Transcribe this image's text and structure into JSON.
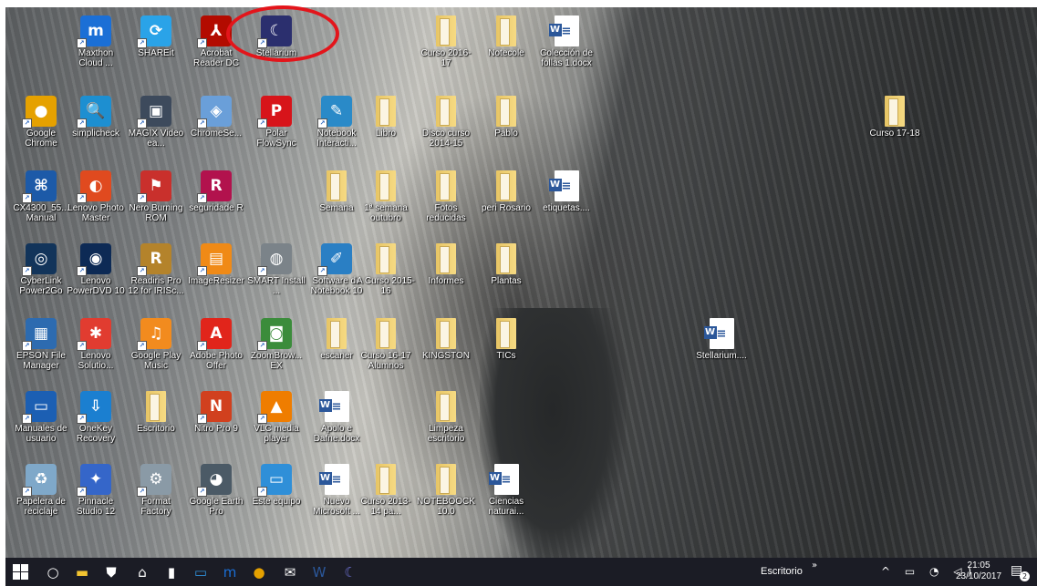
{
  "desktop_icons": [
    {
      "name": "icon-maxthon",
      "label": "Maxthon Cloud ...",
      "icon": "maxthon-icon",
      "glyph": "m",
      "bg": "#1b6fd6",
      "kind": "app"
    },
    {
      "name": "icon-shareit",
      "label": "SHAREit",
      "icon": "shareit-icon",
      "glyph": "⟳",
      "bg": "#2aa3e8",
      "kind": "app"
    },
    {
      "name": "icon-acrobat",
      "label": "Acrobat Reader DC",
      "icon": "acrobat-icon",
      "glyph": "⅄",
      "bg": "#b30b00",
      "kind": "app"
    },
    {
      "name": "icon-stellarium",
      "label": "Stellarium",
      "icon": "stellarium-icon",
      "glyph": "☾",
      "bg": "#2b2f6e",
      "kind": "app"
    },
    {
      "name": "icon-curso-2016-17",
      "label": "Curso 2016-17",
      "icon": "folder-icon",
      "glyph": "",
      "bg": "",
      "kind": "folder"
    },
    {
      "name": "icon-notecole",
      "label": "Notecole",
      "icon": "folder-icon",
      "glyph": "",
      "bg": "",
      "kind": "folder"
    },
    {
      "name": "icon-coleccion-follas",
      "label": "Colección de follas 1.docx",
      "icon": "word-doc-icon",
      "glyph": "≡",
      "bg": "",
      "kind": "doc"
    },
    {
      "name": "icon-google-chrome",
      "label": "Google Chrome",
      "icon": "chrome-icon",
      "glyph": "●",
      "bg": "#e5a100",
      "kind": "app"
    },
    {
      "name": "icon-simplicheck",
      "label": "simplicheck",
      "icon": "magnifier-icon",
      "glyph": "🔍",
      "bg": "#1d8fd1",
      "kind": "app"
    },
    {
      "name": "icon-magix-video",
      "label": "MAGIX Video ea...",
      "icon": "magix-icon",
      "glyph": "▣",
      "bg": "#3d4a5c",
      "kind": "app"
    },
    {
      "name": "icon-chromese",
      "label": "ChromeSe...",
      "icon": "installer-icon",
      "glyph": "◈",
      "bg": "#6a9fd9",
      "kind": "app"
    },
    {
      "name": "icon-polar-flowsync",
      "label": "Polar FlowSync",
      "icon": "polar-icon",
      "glyph": "P",
      "bg": "#d7141a",
      "kind": "app"
    },
    {
      "name": "icon-notebook-interacti",
      "label": "Notebook Interacti...",
      "icon": "notebook-icon",
      "glyph": "✎",
      "bg": "#2a8ac8",
      "kind": "app"
    },
    {
      "name": "icon-libro",
      "label": "Libro",
      "icon": "folder-icon",
      "glyph": "",
      "bg": "",
      "kind": "folder"
    },
    {
      "name": "icon-disco-curso",
      "label": "Disco curso 2014-15",
      "icon": "folder-icon",
      "glyph": "",
      "bg": "",
      "kind": "folder"
    },
    {
      "name": "icon-pablo",
      "label": "Pablo",
      "icon": "folder-icon",
      "glyph": "",
      "bg": "",
      "kind": "folder"
    },
    {
      "name": "icon-curso-17-18",
      "label": "Curso 17-18",
      "icon": "folder-icon",
      "glyph": "",
      "bg": "",
      "kind": "folder"
    },
    {
      "name": "icon-cx4300-manual",
      "label": "CX4300_55... Manual",
      "icon": "manual-icon",
      "glyph": "⌘",
      "bg": "#1c5aa8",
      "kind": "app"
    },
    {
      "name": "icon-lenovo-photo-master",
      "label": "Lenovo Photo Master",
      "icon": "lenovo-photo-icon",
      "glyph": "◐",
      "bg": "#e04a1f",
      "kind": "app"
    },
    {
      "name": "icon-nero-burning-rom",
      "label": "Nero Burning ROM",
      "icon": "nero-icon",
      "glyph": "⚑",
      "bg": "#c9302c",
      "kind": "app"
    },
    {
      "name": "icon-seguridade-r",
      "label": "seguridade R",
      "icon": "r-icon",
      "glyph": "R",
      "bg": "#b2124d",
      "kind": "app"
    },
    {
      "name": "icon-semana",
      "label": "Semana",
      "icon": "folder-icon",
      "glyph": "",
      "bg": "",
      "kind": "folder"
    },
    {
      "name": "icon-1-semana-outubro",
      "label": "1ª semana outubro",
      "icon": "folder-icon",
      "glyph": "",
      "bg": "",
      "kind": "folder"
    },
    {
      "name": "icon-fotos-reducidas",
      "label": "Fotos reducidas",
      "icon": "folder-icon",
      "glyph": "",
      "bg": "",
      "kind": "folder"
    },
    {
      "name": "icon-peri-rosario",
      "label": "peri Rosario",
      "icon": "folder-icon",
      "glyph": "",
      "bg": "",
      "kind": "folder"
    },
    {
      "name": "icon-etiquetas",
      "label": "etiquetas....",
      "icon": "word-doc-icon",
      "glyph": "≡",
      "bg": "",
      "kind": "doc"
    },
    {
      "name": "icon-cyberlink-power2go",
      "label": "CyberLink Power2Go",
      "icon": "power2go-icon",
      "glyph": "◎",
      "bg": "#12345a",
      "kind": "app"
    },
    {
      "name": "icon-lenovo-powerdvd",
      "label": "Lenovo PowerDVD 10",
      "icon": "powerdvd-icon",
      "glyph": "◉",
      "bg": "#0d2a55",
      "kind": "app"
    },
    {
      "name": "icon-readiris-pro",
      "label": "Readiris Pro 12 for IRISc...",
      "icon": "readiris-icon",
      "glyph": "R",
      "bg": "#b4832b",
      "kind": "app"
    },
    {
      "name": "icon-imageresizer",
      "label": "ImageResizer",
      "icon": "image-icon",
      "glyph": "▤",
      "bg": "#f08a16",
      "kind": "app"
    },
    {
      "name": "icon-smart-install",
      "label": "SMART Install ...",
      "icon": "disc-icon",
      "glyph": "◍",
      "bg": "#7b8389",
      "kind": "app"
    },
    {
      "name": "icon-software-notebook",
      "label": "Software de Notebook 10",
      "icon": "notebook-software-icon",
      "glyph": "✐",
      "bg": "#2a7fc4",
      "kind": "app"
    },
    {
      "name": "icon-a-curso-2015-16",
      "label": "A Curso 2015-16",
      "icon": "folder-icon",
      "glyph": "",
      "bg": "",
      "kind": "folder"
    },
    {
      "name": "icon-informes",
      "label": "Informes",
      "icon": "folder-icon",
      "glyph": "",
      "bg": "",
      "kind": "folder"
    },
    {
      "name": "icon-plantas",
      "label": "Plantas",
      "icon": "folder-icon",
      "glyph": "",
      "bg": "",
      "kind": "folder"
    },
    {
      "name": "icon-epson-file-manager",
      "label": "EPSON File Manager",
      "icon": "epson-icon",
      "glyph": "▦",
      "bg": "#2d6bb0",
      "kind": "app"
    },
    {
      "name": "icon-lenovo-solutions",
      "label": "Lenovo Solutio...",
      "icon": "lenovo-solutions-icon",
      "glyph": "✱",
      "bg": "#e13c30",
      "kind": "app"
    },
    {
      "name": "icon-google-play-music",
      "label": "Google Play Music",
      "icon": "headphones-icon",
      "glyph": "♫",
      "bg": "#f28b1e",
      "kind": "app"
    },
    {
      "name": "icon-adobe-photo-offer",
      "label": "Adobe Photo Offer",
      "icon": "adobe-icon",
      "glyph": "A",
      "bg": "#e1251b",
      "kind": "app"
    },
    {
      "name": "icon-zoombrowser-ex",
      "label": "ZoomBrow... EX",
      "icon": "camera-icon",
      "glyph": "◙",
      "bg": "#3b8c3b",
      "kind": "app"
    },
    {
      "name": "icon-escaner",
      "label": "escaner",
      "icon": "folder-icon",
      "glyph": "",
      "bg": "",
      "kind": "folder"
    },
    {
      "name": "icon-curso-16-17-alumnos",
      "label": "Curso 16-17 Alumnos",
      "icon": "folder-icon",
      "glyph": "",
      "bg": "",
      "kind": "folder"
    },
    {
      "name": "icon-kingston",
      "label": "KINGSTON",
      "icon": "folder-icon",
      "glyph": "",
      "bg": "",
      "kind": "folder"
    },
    {
      "name": "icon-tics",
      "label": "TICs",
      "icon": "folder-icon",
      "glyph": "",
      "bg": "",
      "kind": "folder"
    },
    {
      "name": "icon-stellarium-doc",
      "label": "Stellarium....",
      "icon": "word-doc-icon",
      "glyph": "≡",
      "bg": "",
      "kind": "doc"
    },
    {
      "name": "icon-manuales-usuario",
      "label": "Manuales de usuario",
      "icon": "lenovo-manual-icon",
      "glyph": "▭",
      "bg": "#1c5fb3",
      "kind": "app"
    },
    {
      "name": "icon-onekey-recovery",
      "label": "OneKey Recovery",
      "icon": "recovery-icon",
      "glyph": "⇩",
      "bg": "#1b7fd0",
      "kind": "app"
    },
    {
      "name": "icon-escritorio",
      "label": "Escritorio",
      "icon": "folder-icon",
      "glyph": "",
      "bg": "",
      "kind": "folder"
    },
    {
      "name": "icon-nitro-pro-9",
      "label": "Nitro Pro 9",
      "icon": "nitro-icon",
      "glyph": "N",
      "bg": "#d1401e",
      "kind": "app"
    },
    {
      "name": "icon-vlc-media-player",
      "label": "VLC media player",
      "icon": "vlc-cone-icon",
      "glyph": "▲",
      "bg": "#ef7d00",
      "kind": "app"
    },
    {
      "name": "icon-apolo-e-dafne",
      "label": "Apolo e Dafne.docx",
      "icon": "word-doc-icon",
      "glyph": "≡",
      "bg": "",
      "kind": "doc"
    },
    {
      "name": "icon-limpeza-escritorio",
      "label": "Limpeza escritorio",
      "icon": "folder-icon",
      "glyph": "",
      "bg": "",
      "kind": "folder"
    },
    {
      "name": "icon-papelera-reciclaje",
      "label": "Papelera de reciclaje",
      "icon": "recycle-bin-icon",
      "glyph": "♻",
      "bg": "#7fa8c9",
      "kind": "app"
    },
    {
      "name": "icon-pinnacle-studio",
      "label": "Pinnacle Studio 12",
      "icon": "pinnacle-icon",
      "glyph": "✦",
      "bg": "#3566c9",
      "kind": "app"
    },
    {
      "name": "icon-format-factory",
      "label": "Format Factory",
      "icon": "format-factory-icon",
      "glyph": "⚙",
      "bg": "#8a9aa6",
      "kind": "app"
    },
    {
      "name": "icon-google-earth-pro",
      "label": "Google Earth Pro",
      "icon": "earth-icon",
      "glyph": "◕",
      "bg": "#4b5a66",
      "kind": "app"
    },
    {
      "name": "icon-este-equipo",
      "label": "Este equipo",
      "icon": "computer-icon",
      "glyph": "▭",
      "bg": "#2f8fd8",
      "kind": "app"
    },
    {
      "name": "icon-nuevo-microsoft",
      "label": "Nuevo Microsoft ...",
      "icon": "word-doc-icon",
      "glyph": "≡",
      "bg": "",
      "kind": "doc"
    },
    {
      "name": "icon-curso-2013-14",
      "label": "Curso 2013-14 pa...",
      "icon": "folder-icon",
      "glyph": "",
      "bg": "",
      "kind": "folder"
    },
    {
      "name": "icon-notebook-10",
      "label": "NOTEBOOCK 10.0",
      "icon": "folder-icon",
      "glyph": "",
      "bg": "",
      "kind": "folder"
    },
    {
      "name": "icon-ciencias-naturais",
      "label": "Ciencias naturai...",
      "icon": "word-doc-icon",
      "glyph": "≡",
      "bg": "",
      "kind": "doc"
    }
  ],
  "taskbar": {
    "pinned": [
      {
        "name": "start-button",
        "icon": "windows-logo-icon",
        "glyph": "",
        "color": "#ffffff"
      },
      {
        "name": "cortana-search-button",
        "icon": "cortana-circle-icon",
        "glyph": "○",
        "color": "#ffffff"
      },
      {
        "name": "file-explorer-button",
        "icon": "file-explorer-icon",
        "glyph": "▬",
        "color": "#f3c431"
      },
      {
        "name": "store-button",
        "icon": "store-bag-icon",
        "glyph": "⛊",
        "color": "#ffffff"
      },
      {
        "name": "home-button",
        "icon": "home-icon",
        "glyph": "⌂",
        "color": "#ffffff"
      },
      {
        "name": "document-button",
        "icon": "document-icon",
        "glyph": "▮",
        "color": "#ffffff"
      },
      {
        "name": "this-pc-button",
        "icon": "monitor-icon",
        "glyph": "▭",
        "color": "#2f8fd8"
      },
      {
        "name": "maxthon-button",
        "icon": "maxthon-icon",
        "glyph": "m",
        "color": "#1b6fd6"
      },
      {
        "name": "chrome-button",
        "icon": "chrome-icon",
        "glyph": "●",
        "color": "#e5a100"
      },
      {
        "name": "mail-button",
        "icon": "mail-envelope-icon",
        "glyph": "✉",
        "color": "#ffffff"
      },
      {
        "name": "word-button",
        "icon": "word-icon",
        "glyph": "W",
        "color": "#2b579a"
      },
      {
        "name": "stellarium-button",
        "icon": "stellarium-icon",
        "glyph": "☾",
        "color": "#6b6fd0"
      }
    ],
    "toolbar_label": "Escritorio",
    "overflow_glyph": "»",
    "tray_glyphs": "^ ▭ ◔ ◁)",
    "time": "21:05",
    "date": "23/10/2017",
    "notification_count": "2"
  }
}
